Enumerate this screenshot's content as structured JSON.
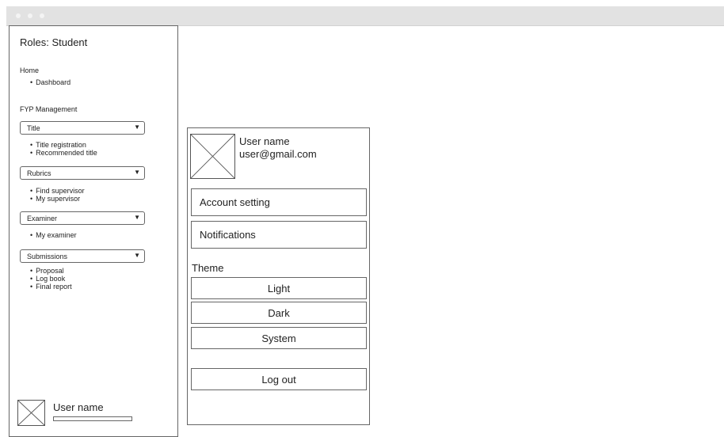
{
  "sidebar": {
    "role_title": "Roles: Student",
    "home": {
      "label": "Home",
      "items": [
        "Dashboard"
      ]
    },
    "fyp": {
      "label": "FYP Management",
      "groups": [
        {
          "dropdown": "Title",
          "items": [
            "Title registration",
            "Recommended title"
          ]
        },
        {
          "dropdown": "Rubrics",
          "items": [
            "Find supervisor",
            "My supervisor"
          ]
        },
        {
          "dropdown": "Examiner",
          "items": [
            "My examiner"
          ]
        },
        {
          "dropdown": "Submissions",
          "items": [
            "Proposal",
            "Log book",
            "Final report"
          ]
        }
      ]
    },
    "footer_user": {
      "name": "User name"
    }
  },
  "icons": {
    "dropdown_caret": "▼",
    "avatar": "placeholder-x-box"
  },
  "account_panel": {
    "user_name": "User name",
    "email": "user@gmail.com",
    "account_setting": "Account setting",
    "notifications": "Notifications",
    "theme_label": "Theme",
    "theme_options": [
      "Light",
      "Dark",
      "System"
    ],
    "logout": "Log out"
  }
}
